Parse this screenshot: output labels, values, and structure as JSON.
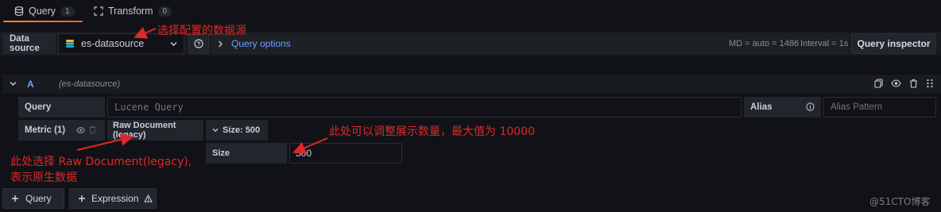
{
  "tabs": [
    {
      "label": "Query",
      "count": "1"
    },
    {
      "label": "Transform",
      "count": "0"
    }
  ],
  "datasource": {
    "label": "Data source",
    "selected": "es-datasource",
    "query_options": "Query options",
    "md": "MD = auto = 1486",
    "interval": "Interval = 1s",
    "inspector": "Query inspector"
  },
  "query": {
    "ref": "A",
    "ds": "(es-datasource)",
    "query_label": "Query",
    "query_placeholder": "Lucene Query",
    "alias_label": "Alias",
    "alias_placeholder": "Alias Pattern",
    "metric_label": "Metric (1)",
    "metric_type": "Raw Document (legacy)",
    "size_toggle": "Size: 500",
    "size_label": "Size",
    "size_value": "500"
  },
  "footer": {
    "add_query": "Query",
    "add_expression": "Expression"
  },
  "annotations": {
    "a1": "选择配置的数据源",
    "a2": "此处可以调整展示数量，最大值为 10000",
    "a3_line1": "此处选择 Raw Document(legacy),",
    "a3_line2": "表示原生数据"
  },
  "watermark": "@51CTO博客",
  "colors": {
    "accent": "#ff8833",
    "link": "#6e9fff",
    "annotation": "#e02828"
  }
}
